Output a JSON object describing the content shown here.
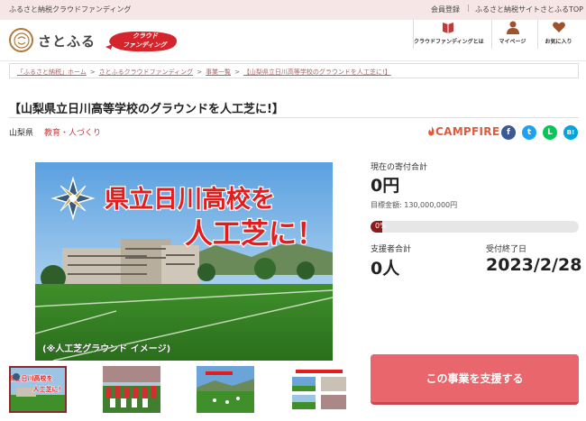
{
  "topbar": {
    "tagline": "ふるさと納税クラウドファンディング",
    "register": "会員登録",
    "separator": "|",
    "site_top": "ふるさと納税サイトさとふるTOP"
  },
  "header": {
    "logo_mark": "さと\nふる",
    "logo_text": "さとふる",
    "badge_line1": "クラウド",
    "badge_line2": "ファンディング",
    "nav": [
      {
        "label": "クラウドファンディングとは",
        "icon": "book-icon"
      },
      {
        "label": "マイページ",
        "icon": "user-icon"
      },
      {
        "label": "お気に入り",
        "icon": "heart-icon"
      }
    ]
  },
  "breadcrumb": [
    "「ふるさと納税」ホーム",
    "さとふるクラウドファンディング",
    "事業一覧",
    "【山梨県立日川高等学校のグラウンドを人工芝に!】"
  ],
  "breadcrumb_sep": ">",
  "project": {
    "title": "【山梨県立日川高等学校のグラウンドを人工芝に!】",
    "prefecture": "山梨県",
    "category": "教育・人づくり",
    "platform": "CAMPFIRE",
    "share": [
      {
        "icon": "facebook-icon",
        "glyph": "f",
        "color": "#3b5998"
      },
      {
        "icon": "twitter-icon",
        "glyph": "t",
        "color": "#1da1f2"
      },
      {
        "icon": "line-icon",
        "glyph": "L",
        "color": "#06c755"
      },
      {
        "icon": "hatena-icon",
        "glyph": "B!",
        "color": "#00a4de"
      }
    ],
    "hero": {
      "headline_1": "県立日川高校を",
      "headline_2": "人工芝に！",
      "caption": "(※人工芝グラウンド イメージ)"
    }
  },
  "thumbnails": [
    {
      "headline_1": "県立日川高校を",
      "headline_2": "人工芝に！"
    },
    {
      "headline_1": ""
    },
    {
      "headline_1": ""
    },
    {
      "headline_1": ""
    }
  ],
  "funding": {
    "current_label": "現在の寄付合計",
    "current_amount": "0円",
    "target_label": "目標金額: 130,000,000円",
    "progress_text": "0%",
    "progress_fraction": 0,
    "supporters_label": "支援者合計",
    "supporters_value": "0人",
    "deadline_label": "受付終了日",
    "deadline_value": "2023/2/28"
  },
  "support_button": "この事業を支援する",
  "colors": {
    "accent": "#e8666c",
    "progress": "#8b1a1a",
    "topbar_bg": "#f7e6e6",
    "campfire": "#e05a3a"
  }
}
